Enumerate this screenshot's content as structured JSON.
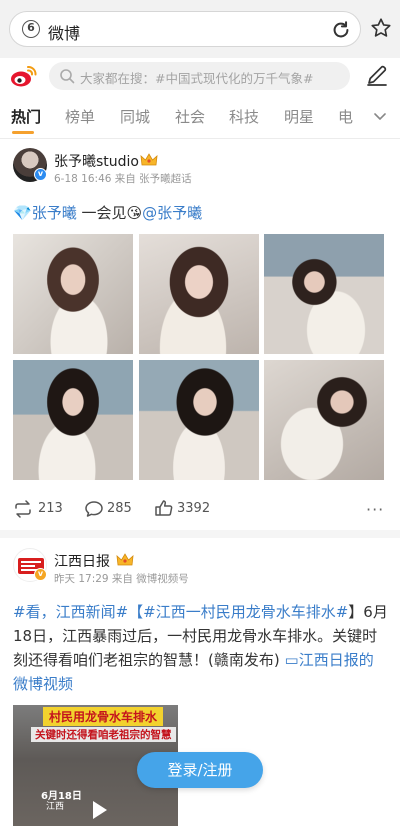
{
  "browser": {
    "url": "微博"
  },
  "search": {
    "placeholder": "大家都在搜：#中国式现代化的万千气象#"
  },
  "tabs": [
    "热门",
    "榜单",
    "同城",
    "社会",
    "科技",
    "明星",
    "电"
  ],
  "colors": {
    "accent": "#f5a12e",
    "link": "#3a7dc9",
    "button": "#45a4e9",
    "verified": "#2d8cf0"
  },
  "post1": {
    "author": "张予曦studio",
    "meta": "6-18 16:46 来自 张予曦超话",
    "mention1": "张予曦",
    "text": " 一会见",
    "emoji": "😘",
    "mention2": "@张予曦",
    "reposts": "213",
    "comments": "285",
    "likes": "3392",
    "more": "···"
  },
  "post2": {
    "author": "江西日报",
    "meta": "昨天 17:29 来自 微博视频号",
    "tag1": "#看，江西新闻#",
    "bracket_open": "【",
    "tag2": "#江西一村民用龙骨水车排水#",
    "body": "】6月18日，江西暴雨过后，一村民用龙骨水车排水。关键时刻还得看咱们老祖宗的智慧！(赣南发布)",
    "video_link_line1": "江西日",
    "video_link_line2": "报的微博视频",
    "video": {
      "banner": "村民用龙骨水车排水",
      "subtitle": "关键时还得看咱老祖宗的智慧",
      "date": "6月18日",
      "location": "江西"
    }
  },
  "login_button": "登录/注册"
}
